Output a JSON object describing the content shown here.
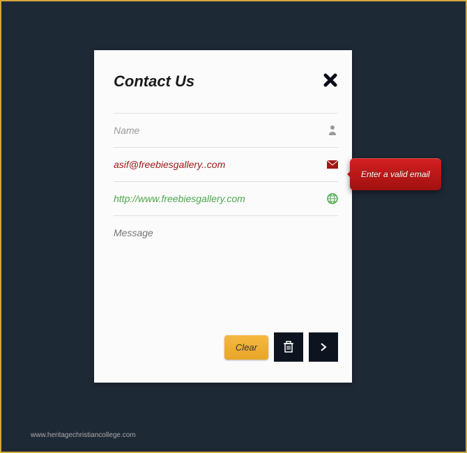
{
  "modal": {
    "title": "Contact Us",
    "name_placeholder": "Name",
    "email_value": "asif@freebiesgallery..com",
    "url_value": "http://www.freebiesgallery.com",
    "message_placeholder": "Message"
  },
  "actions": {
    "clear_label": "Clear"
  },
  "tooltip": {
    "email_error": "Enter a valid email"
  },
  "watermark": "www.heritagechristiancollege.com"
}
